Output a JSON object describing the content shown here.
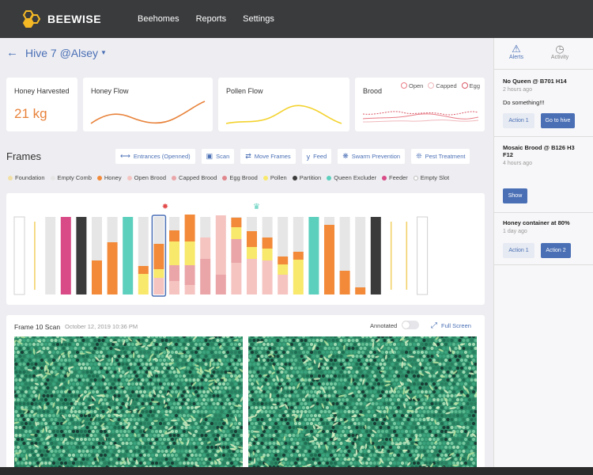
{
  "app": {
    "brand": "BEEWISE",
    "nav": [
      "Beehomes",
      "Reports",
      "Settings"
    ]
  },
  "hive": {
    "title": "Hive 7 @Alsey"
  },
  "cards": {
    "honey_harvested": {
      "title": "Honey Harvested",
      "value": "21 kg"
    },
    "honey_flow": {
      "title": "Honey Flow"
    },
    "pollen_flow": {
      "title": "Pollen Flow"
    },
    "brood": {
      "title": "Brood",
      "legend": [
        "Open",
        "Capped",
        "Egg"
      ]
    }
  },
  "frames": {
    "title": "Frames",
    "actions": [
      {
        "label": "Entrances (Openned)",
        "icon": "arrows-horizontal-icon"
      },
      {
        "label": "Scan",
        "icon": "camera-icon"
      },
      {
        "label": "Move Frames",
        "icon": "swap-arrows-icon"
      },
      {
        "label": "Feed",
        "icon": "utensils-icon"
      },
      {
        "label": "Swarm Prevention",
        "icon": "swarm-icon"
      },
      {
        "label": "Pest Treatment",
        "icon": "bug-icon"
      }
    ],
    "legend": [
      {
        "label": "Foundation",
        "color": "#f2dfa6"
      },
      {
        "label": "Empty Comb",
        "color": "#e6e6e6"
      },
      {
        "label": "Honey",
        "color": "#f28a3a"
      },
      {
        "label": "Open Brood",
        "color": "#f5c4c1"
      },
      {
        "label": "Capped Brood",
        "color": "#eaa5a8"
      },
      {
        "label": "Egg Brood",
        "color": "#e0868d"
      },
      {
        "label": "Pollen",
        "color": "#f8e86b"
      },
      {
        "label": "Partition",
        "color": "#3b3b3b"
      },
      {
        "label": "Queen Excluder",
        "color": "#5ccfbd"
      },
      {
        "label": "Feeder",
        "color": "#d84b86"
      },
      {
        "label": "Empty Slot",
        "color": "#ffffff"
      }
    ]
  },
  "scan": {
    "title": "Frame 10 Scan",
    "date": "October 12, 2019 10:36 PM",
    "annotated_label": "Annotated",
    "fullscreen_label": "Full Screen"
  },
  "sidebar": {
    "tabs": [
      {
        "label": "Alerts",
        "icon": "warning-icon"
      },
      {
        "label": "Activity",
        "icon": "clock-icon"
      }
    ],
    "alerts": [
      {
        "title": "No Queen @ B701 H14",
        "time": "2 hours ago",
        "message": "Do something!!!",
        "buttons": [
          "Action 1",
          "Go to hive"
        ]
      },
      {
        "title": "Mosaic Brood @ B126 H3 F12",
        "time": "4 hours ago",
        "message": "",
        "buttons": [
          "Show"
        ]
      },
      {
        "title": "Honey container at 80%",
        "time": "1 day ago",
        "message": "",
        "buttons": [
          "Action 1",
          "Action 2"
        ]
      }
    ]
  }
}
